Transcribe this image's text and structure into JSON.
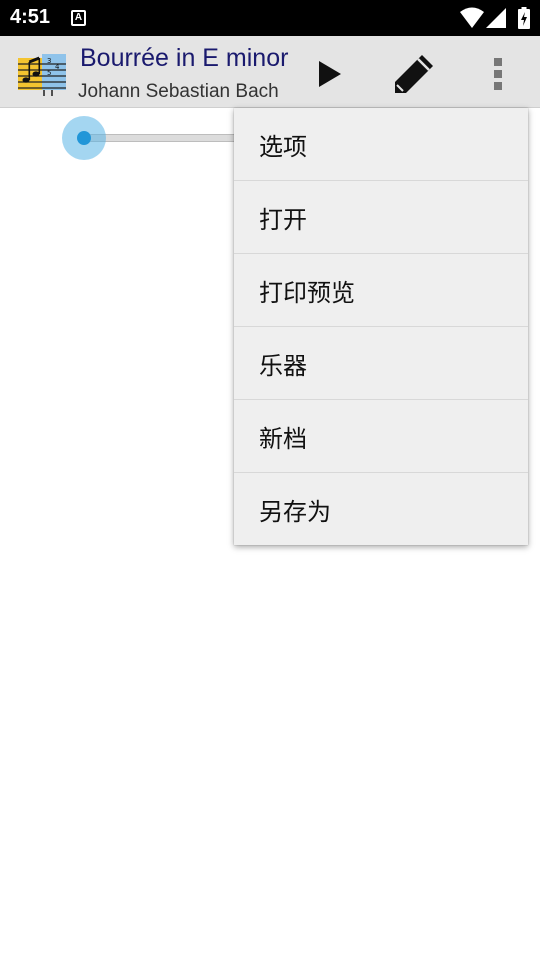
{
  "status_bar": {
    "time": "4:51",
    "notification_icon": "A"
  },
  "toolbar": {
    "title": "Bourrée in E minor",
    "subtitle": "Johann Sebastian Bach",
    "app_icon": "music-score-icon",
    "actions": [
      "play-icon",
      "pencil-icon",
      "more-vert-icon"
    ]
  },
  "slider": {
    "position": 0
  },
  "menu": {
    "items": [
      {
        "label": "选项"
      },
      {
        "label": "打开"
      },
      {
        "label": "打印预览"
      },
      {
        "label": "乐器"
      },
      {
        "label": "新档"
      },
      {
        "label": "另存为"
      }
    ]
  },
  "colors": {
    "toolbar_bg": "#e4e4e4",
    "title_color": "#1a1a6e",
    "accent": "#2196d8",
    "menu_bg": "#efefef"
  }
}
